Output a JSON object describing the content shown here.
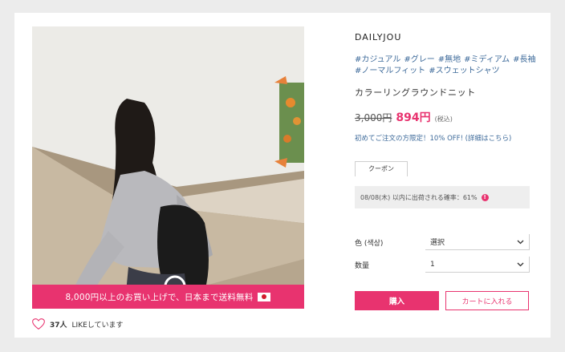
{
  "promo": {
    "text": "8,000円以上のお買い上げで、日本まで送料無料"
  },
  "like": {
    "count": "37人",
    "suffix": "LIKEしています"
  },
  "product": {
    "brand": "DAILYJOU",
    "tags": [
      "#カジュアル",
      "#グレー",
      "#無地",
      "#ミディアム",
      "#長袖",
      "#ノーマルフィット",
      "#スウェットシャツ"
    ],
    "title": "カラーリングラウンドニット",
    "old_price": "3,000円",
    "price": "894円",
    "tax_note": "(税込)",
    "first_order_note": "初めてご注文の方限定！10% OFF! (詳細はこちら)"
  },
  "coupon": {
    "tab_label": "クーポン"
  },
  "shipping": {
    "text": "08/08(木) 以内に出荷される確率：61%"
  },
  "options": {
    "color_label": "色 (색상)",
    "color_value": "選択",
    "qty_label": "数量",
    "qty_value": "1"
  },
  "buttons": {
    "buy": "購入",
    "cart": "カートに入れる"
  },
  "colors": {
    "accent": "#e8336f",
    "link": "#3d6a9a"
  }
}
